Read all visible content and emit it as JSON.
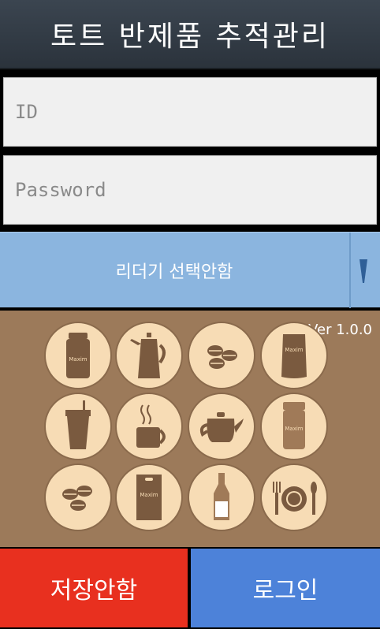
{
  "header": {
    "title": "토트 반제품 추적관리"
  },
  "form": {
    "id_placeholder": "ID",
    "password_placeholder": "Password",
    "reader_select": {
      "selected": "리더기 선택안함"
    }
  },
  "banner": {
    "version": "Ver 1.0.0",
    "brand": "Maxim",
    "icons": [
      "coffee-jar-icon",
      "coffee-pot-icon",
      "coffee-beans-icon",
      "coffee-pouch-icon",
      "takeout-cup-icon",
      "hot-mug-icon",
      "teapot-icon",
      "coffee-jar-icon",
      "coffee-beans-icon",
      "coffee-bag-icon",
      "syrup-bottle-icon",
      "plate-cutlery-icon"
    ]
  },
  "buttons": {
    "save": "저장안함",
    "login": "로그인"
  },
  "colors": {
    "title_bar": "#2f3842",
    "selector": "#8bb5df",
    "banner": "#9c7a5a",
    "circle": "#f7dcb5",
    "icon": "#7a5a3f",
    "save": "#e8301f",
    "login": "#4d82d9"
  }
}
